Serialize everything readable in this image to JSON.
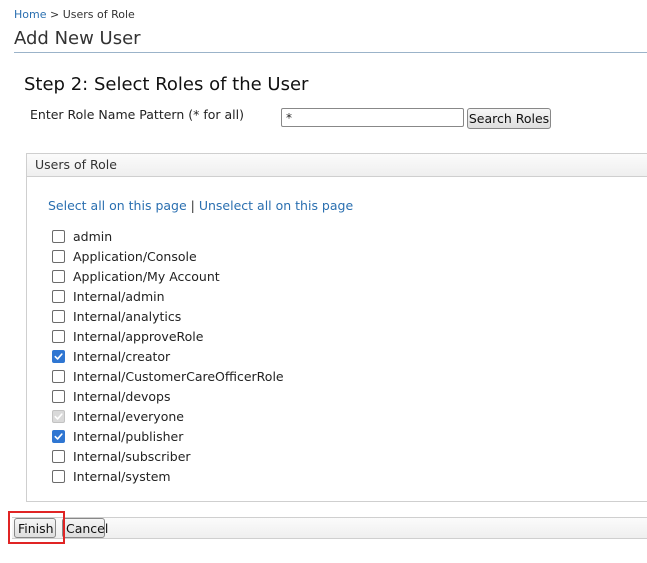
{
  "breadcrumb": {
    "home": "Home",
    "separator": " > ",
    "current": "Users of Role"
  },
  "page_title": "Add New User",
  "step_title": "Step 2: Select Roles of the User",
  "search": {
    "label": "Enter Role Name Pattern (* for all)",
    "value": "*",
    "button_label": "Search Roles"
  },
  "panel": {
    "header": "Users of Role",
    "select_all": "Select all on this page",
    "link_separator": " | ",
    "unselect_all": "Unselect all on this page",
    "roles": [
      {
        "label": "admin",
        "checked": false,
        "disabled": false
      },
      {
        "label": "Application/Console",
        "checked": false,
        "disabled": false
      },
      {
        "label": "Application/My Account",
        "checked": false,
        "disabled": false
      },
      {
        "label": "Internal/admin",
        "checked": false,
        "disabled": false
      },
      {
        "label": "Internal/analytics",
        "checked": false,
        "disabled": false
      },
      {
        "label": "Internal/approveRole",
        "checked": false,
        "disabled": false
      },
      {
        "label": "Internal/creator",
        "checked": true,
        "disabled": false
      },
      {
        "label": "Internal/CustomerCareOfficerRole",
        "checked": false,
        "disabled": false
      },
      {
        "label": "Internal/devops",
        "checked": false,
        "disabled": false
      },
      {
        "label": "Internal/everyone",
        "checked": true,
        "disabled": true
      },
      {
        "label": "Internal/publisher",
        "checked": true,
        "disabled": false
      },
      {
        "label": "Internal/subscriber",
        "checked": false,
        "disabled": false
      },
      {
        "label": "Internal/system",
        "checked": false,
        "disabled": false
      }
    ]
  },
  "buttons": {
    "finish": "Finish",
    "cancel": "Cancel"
  },
  "colors": {
    "link": "#2a6fb0",
    "checkbox_checked": "#2f76d2",
    "highlight": "#e02424"
  }
}
